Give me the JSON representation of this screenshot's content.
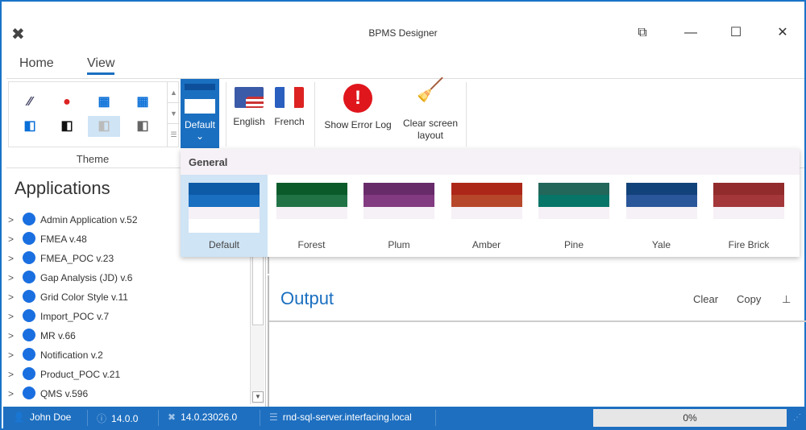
{
  "window": {
    "title": "BPMS Designer",
    "restore": "⧉",
    "minimize": "—",
    "maximize": "☐",
    "close": "✕"
  },
  "tabs": [
    {
      "label": "Home"
    },
    {
      "label": "View"
    }
  ],
  "ribbon": {
    "theme_group": "Theme",
    "default_button": "Default",
    "english": "English",
    "french": "French",
    "show_error_log": "Show Error Log",
    "clear_screen_layout": "Clear screen layout"
  },
  "theme_popup": {
    "header": "General",
    "themes": [
      {
        "name": "Default",
        "top": "#0d5aa7",
        "mid": "#1a6fc0",
        "low": "#f6f1f6",
        "white": true
      },
      {
        "name": "Forest",
        "top": "#0b5b2a",
        "mid": "#217346",
        "low": "#f6f1f6"
      },
      {
        "name": "Plum",
        "top": "#682b6a",
        "mid": "#823a80",
        "low": "#f6f1f6"
      },
      {
        "name": "Amber",
        "top": "#ad2719",
        "mid": "#b7472a",
        "low": "#f6f1f6"
      },
      {
        "name": "Pine",
        "top": "#23665a",
        "mid": "#077568",
        "low": "#f6f1f6"
      },
      {
        "name": "Yale",
        "top": "#12427a",
        "mid": "#2a569a",
        "low": "#f6f1f6"
      },
      {
        "name": "Fire Brick",
        "top": "#922b2b",
        "mid": "#a4373a",
        "low": "#f6f1f6"
      }
    ]
  },
  "applications": {
    "title": "Applications",
    "items": [
      "Admin Application v.52",
      "FMEA v.48",
      "FMEA_POC v.23",
      "Gap Analysis (JD) v.6",
      "Grid Color Style v.11",
      "Import_POC v.7",
      "MR v.66",
      "Notification v.2",
      "Product_POC v.21",
      "QMS v.596"
    ]
  },
  "output": {
    "title": "Output",
    "clear": "Clear",
    "copy": "Copy",
    "pin": "⊥"
  },
  "status": {
    "user": "John Doe",
    "version": "14.0.0",
    "build": "14.0.23026.0",
    "server": "rnd-sql-server.interfacing.local",
    "progress": "0%",
    "progress_value": 0
  },
  "colors": {
    "accent": "#1a6fc0",
    "status_bar": "#1e6fc0"
  }
}
